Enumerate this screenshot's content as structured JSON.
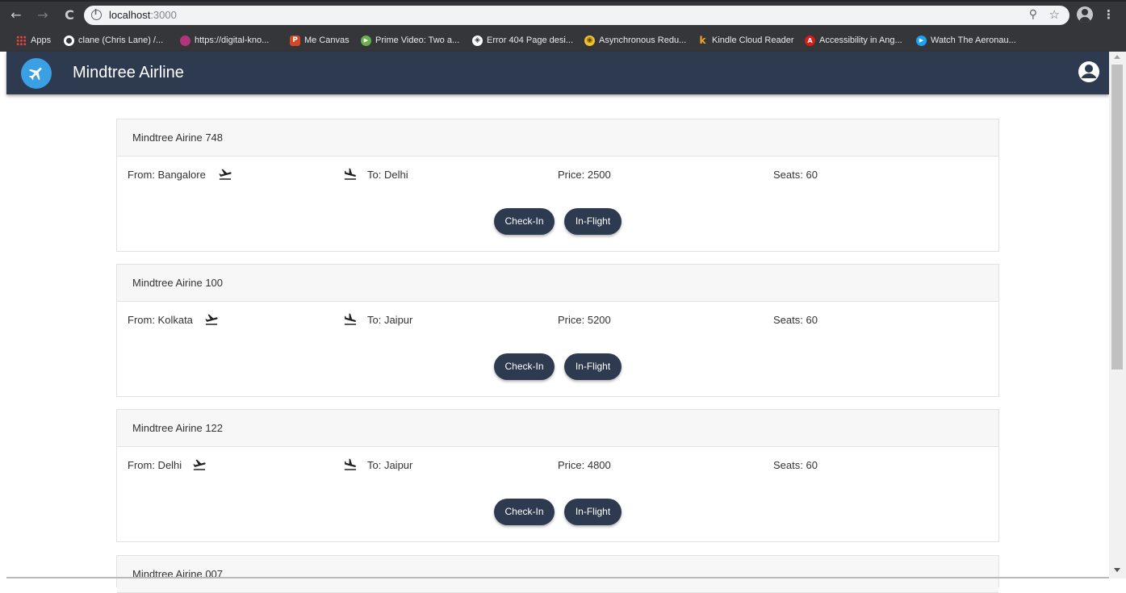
{
  "browser": {
    "url_host": "localhost",
    "url_port": ":3000",
    "back_glyph": "←",
    "forward_glyph": "→",
    "reload_glyph": "C",
    "zoom_glyph": "⚲",
    "star_glyph": "☆",
    "menu_glyph": "⋮",
    "bookmarks": [
      {
        "label": "Apps",
        "icon": "apps-grid-icon",
        "color": "#e8453c"
      },
      {
        "label": "clane (Chris Lane) /...",
        "icon": "github-icon",
        "color": "#ffffff"
      },
      {
        "label": "https://digital-kno...",
        "icon": "digital-knowledge-icon",
        "color": "#b0357a"
      },
      {
        "label": "Me Canvas",
        "icon": "powerpoint-icon",
        "color": "#d24726",
        "glyph": "P"
      },
      {
        "label": "Prime Video: Two a...",
        "icon": "prime-video-icon",
        "color": "#6ab04c",
        "glyph": "▶"
      },
      {
        "label": "Error 404 Page desi...",
        "icon": "codepen-icon",
        "color": "#ffffff",
        "glyph": "◈"
      },
      {
        "label": "Asynchronous Redu...",
        "icon": "redux-icon",
        "color": "#f2c12e",
        "glyph": "◉"
      },
      {
        "label": "Kindle Cloud Reader",
        "icon": "kindle-icon",
        "color": "#f5a623",
        "glyph": "k"
      },
      {
        "label": "Accessibility in Ang...",
        "icon": "angular-icon",
        "color": "#dd1b16",
        "glyph": "A"
      },
      {
        "label": "Watch The Aeronau...",
        "icon": "play-icon",
        "color": "#1da1f2",
        "glyph": "▶"
      }
    ]
  },
  "app": {
    "title": "Mindtree Airline",
    "colors": {
      "bar": "#2d3a4f",
      "logo": "#3aa0e3",
      "button": "#2d3a4f"
    }
  },
  "buttons": {
    "checkin": "Check-In",
    "inflight": "In-Flight"
  },
  "flights": [
    {
      "name": "Mindtree Airine 748",
      "from": "From: Bangalore",
      "to": "To: Delhi",
      "price": "Price: 2500",
      "seats": "Seats: 60"
    },
    {
      "name": "Mindtree Airine 100",
      "from": "From: Kolkata",
      "to": "To: Jaipur",
      "price": "Price: 5200",
      "seats": "Seats: 60"
    },
    {
      "name": "Mindtree Airine 122",
      "from": "From: Delhi",
      "to": "To: Jaipur",
      "price": "Price: 4800",
      "seats": "Seats: 60"
    },
    {
      "name": "Mindtree Airine 007"
    }
  ]
}
